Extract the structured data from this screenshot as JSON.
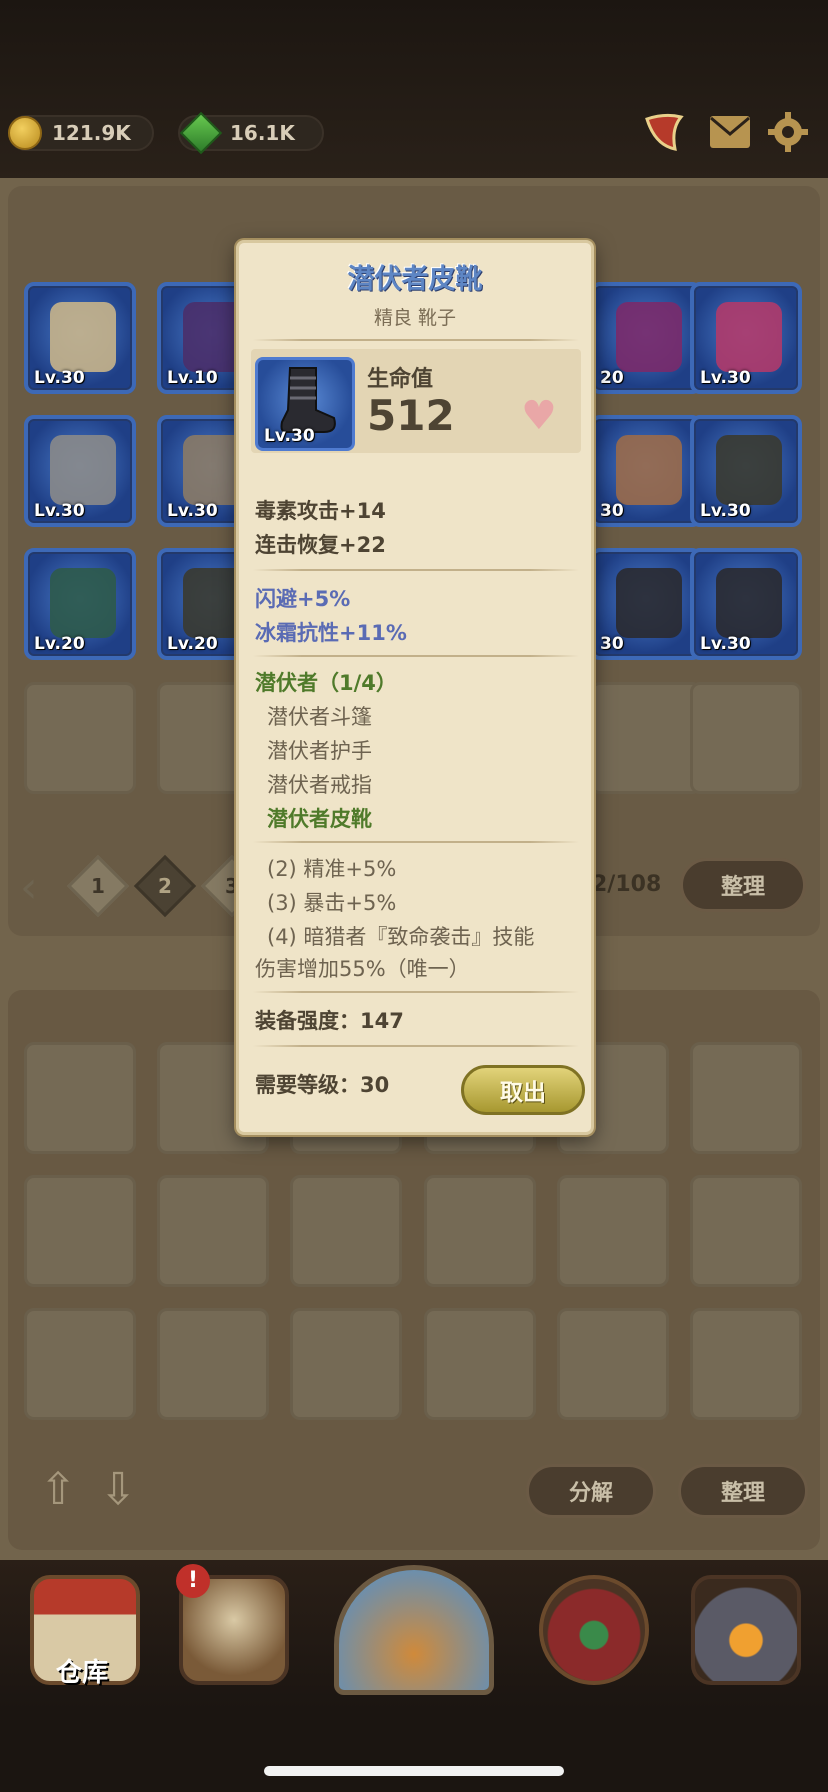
{
  "top": {
    "gold": "121.9K",
    "gems": "16.1K",
    "icons": [
      "horn-icon",
      "mail-icon",
      "settings-gear-icon"
    ]
  },
  "storage": {
    "row1": [
      {
        "level": "Lv.30",
        "kind": "dagger"
      },
      {
        "level": "Lv.10",
        "kind": "shield"
      },
      {
        "level": "",
        "kind": "hidden"
      },
      {
        "level": "",
        "kind": "hidden"
      },
      {
        "level": "20",
        "kind": "hat"
      },
      {
        "level": "Lv.30",
        "kind": "amulet"
      }
    ],
    "row2": [
      {
        "level": "Lv.30",
        "kind": "armor"
      },
      {
        "level": "Lv.30",
        "kind": "cloak"
      },
      {
        "level": "",
        "kind": "hidden"
      },
      {
        "level": "",
        "kind": "hidden"
      },
      {
        "level": "30",
        "kind": "mask"
      },
      {
        "level": "Lv.30",
        "kind": "gloves"
      }
    ],
    "row3": [
      {
        "level": "Lv.20",
        "kind": "gauntlet"
      },
      {
        "level": "Lv.20",
        "kind": "gloves"
      },
      {
        "level": "",
        "kind": "hidden"
      },
      {
        "level": "",
        "kind": "hidden"
      },
      {
        "level": "30",
        "kind": "boots"
      },
      {
        "level": "Lv.30",
        "kind": "boots"
      }
    ],
    "pagination": {
      "pages": [
        "1",
        "2",
        "3"
      ],
      "active_page": "2",
      "counter": "2/108",
      "sort_label": "整理"
    }
  },
  "bag": {
    "decompose_label": "分解",
    "sort_label": "整理"
  },
  "bottom_nav": {
    "warehouse_label": "仓库",
    "alert_badge": "!"
  },
  "tooltip": {
    "name": "潜伏者皮靴",
    "subtitle": "精良 靴子",
    "item_level": "Lv.30",
    "main_stat_label": "生命值",
    "main_stat_value": "512",
    "stats_white": [
      "毒素攻击+14",
      "连击恢复+22"
    ],
    "stats_blue": [
      "闪避+5%",
      "冰霜抗性+11%"
    ],
    "set": {
      "title": "潜伏者（1/4）",
      "pieces": [
        "潜伏者斗篷",
        "潜伏者护手",
        "潜伏者戒指",
        "潜伏者皮靴"
      ],
      "bonuses": [
        "(2) 精准+5%",
        "(3) 暴击+5%",
        "(4) 暗猎者『致命袭击』技能",
        "伤害增加55%（唯一）"
      ]
    },
    "power": "装备强度：147",
    "required_level": "需要等级：30",
    "take_out_label": "取出"
  },
  "colors": {
    "rare_blue": "#3d69b7",
    "set_green": "#4f7a2a",
    "affix_blue": "#5a6bb4",
    "title_blue": "#5e86c4"
  }
}
